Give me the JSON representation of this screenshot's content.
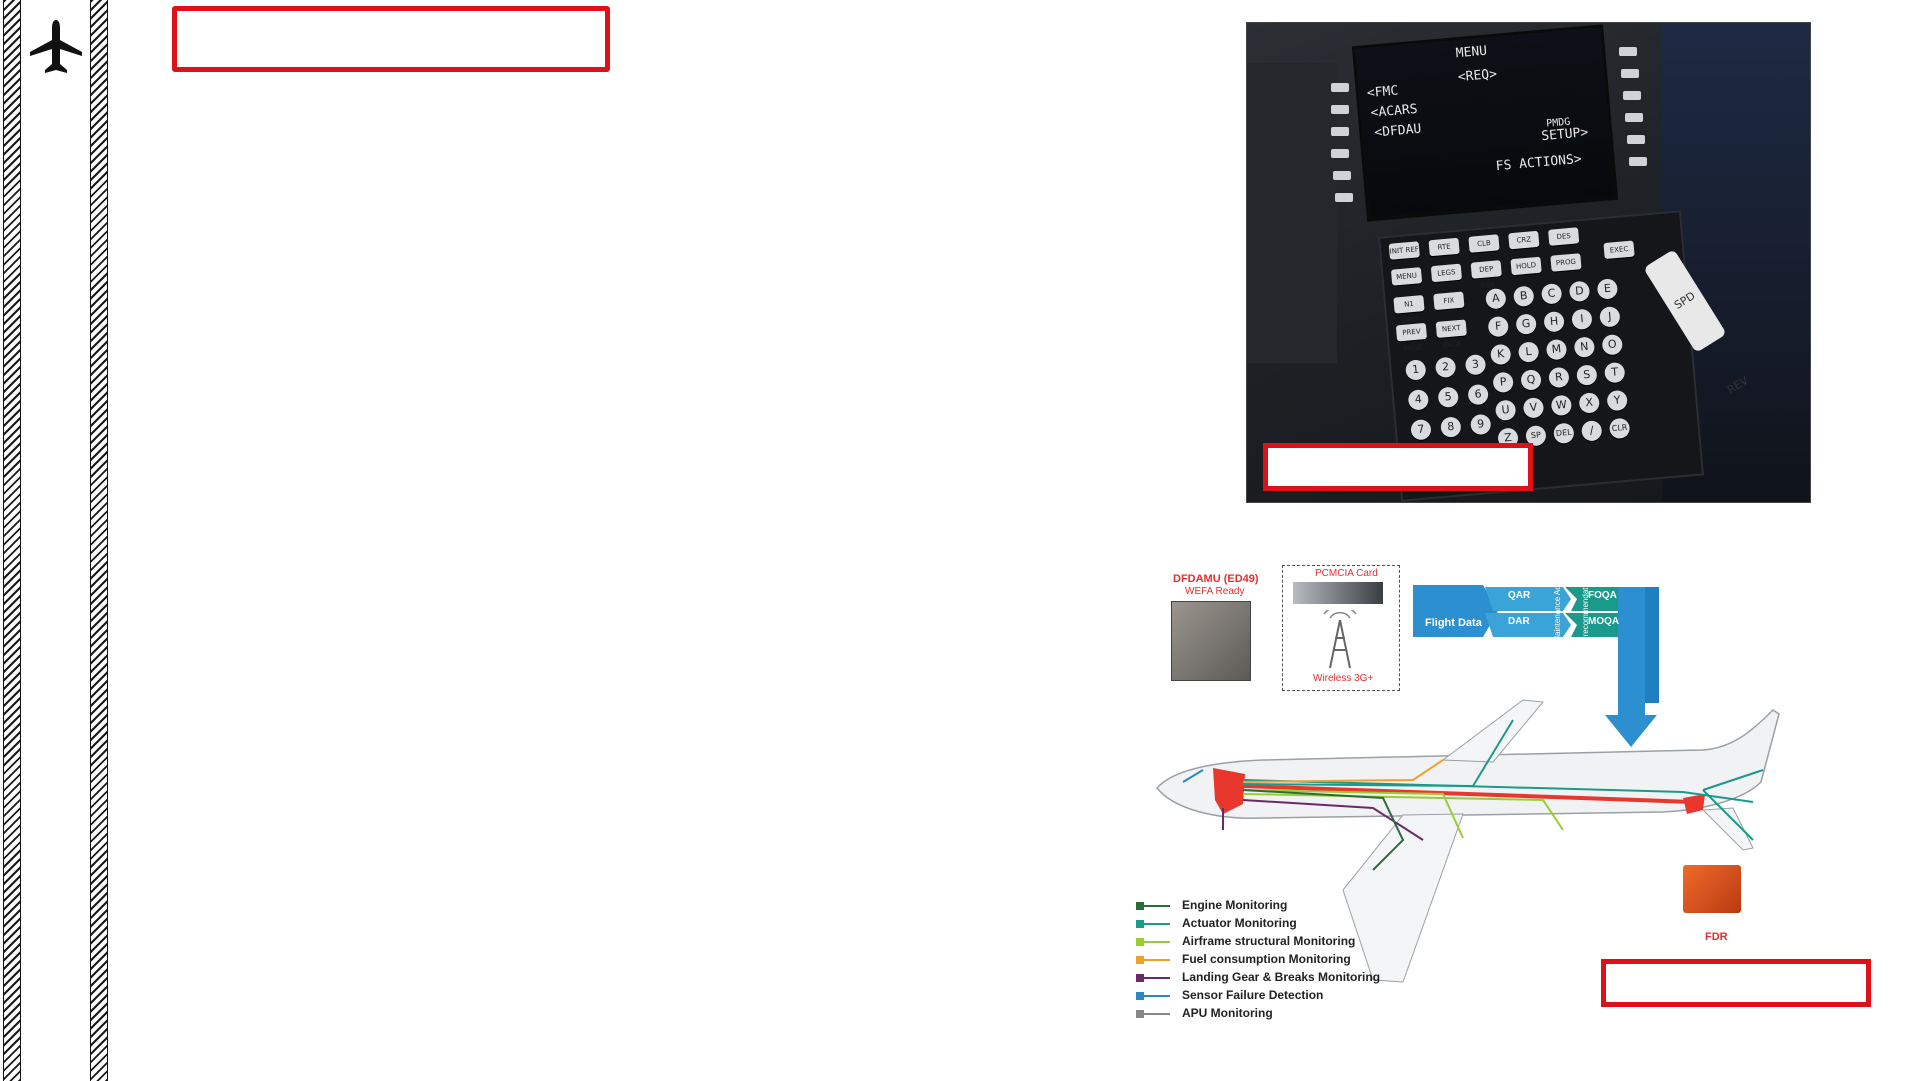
{
  "cdu": {
    "screen": {
      "title": "MENU",
      "left": [
        "<FMC",
        "<ACARS",
        "<DFDAU"
      ],
      "req": "<REQ>",
      "right_small": "PMDG",
      "setup": "SETUP>",
      "fs_actions": "FS ACTIONS>"
    },
    "function_keys": [
      "INIT REF",
      "RTE",
      "CLB",
      "CRZ",
      "DES",
      "MENU",
      "LEGS",
      "DEP ARR",
      "HOLD",
      "PROG",
      "EXEC",
      "N1 LIMIT",
      "FIX",
      "PREV PAGE",
      "NEXT PAGE"
    ],
    "number_keys": [
      "1",
      "2",
      "3",
      "4",
      "5",
      "6",
      "7",
      "8",
      "9"
    ],
    "letter_keys": [
      "A",
      "B",
      "C",
      "D",
      "E",
      "F",
      "G",
      "H",
      "I",
      "J",
      "K",
      "L",
      "M",
      "N",
      "O",
      "P",
      "Q",
      "R",
      "S",
      "T",
      "U",
      "V",
      "W",
      "X",
      "Y",
      "Z",
      "SP",
      "DEL",
      "/",
      "CLR"
    ],
    "lever_label": "SPD REV"
  },
  "diagram": {
    "dfdamu_title": "DFDAMU (ED49)",
    "dfdamu_sub": "WEFA Ready",
    "pcmcia": "PCMCIA Card",
    "wireless": "Wireless 3G+",
    "flight_data": "Flight Data",
    "qar": "QAR",
    "dar": "DAR",
    "foqa": "FOQA",
    "moqa": "MOQA",
    "predictive": "Predictive Maintenance Actions",
    "operational": "Operational recommendations",
    "fdr": "FDR",
    "legend": [
      {
        "label": "Engine Monitoring",
        "color": "#2e6b3a"
      },
      {
        "label": "Actuator Monitoring",
        "color": "#1a9a8a"
      },
      {
        "label": "Airframe structural Monitoring",
        "color": "#9acd32"
      },
      {
        "label": "Fuel consumption Monitoring",
        "color": "#f0a030"
      },
      {
        "label": "Landing Gear & Breaks Monitoring",
        "color": "#6a2a6a"
      },
      {
        "label": "Sensor Failure Detection",
        "color": "#2a8ac0"
      },
      {
        "label": "APU Monitoring",
        "color": "#888888"
      }
    ]
  },
  "colors": {
    "accent_red": "#e01018",
    "diagram_blue": "#2b8fd0",
    "diagram_teal": "#1a9a8a"
  }
}
